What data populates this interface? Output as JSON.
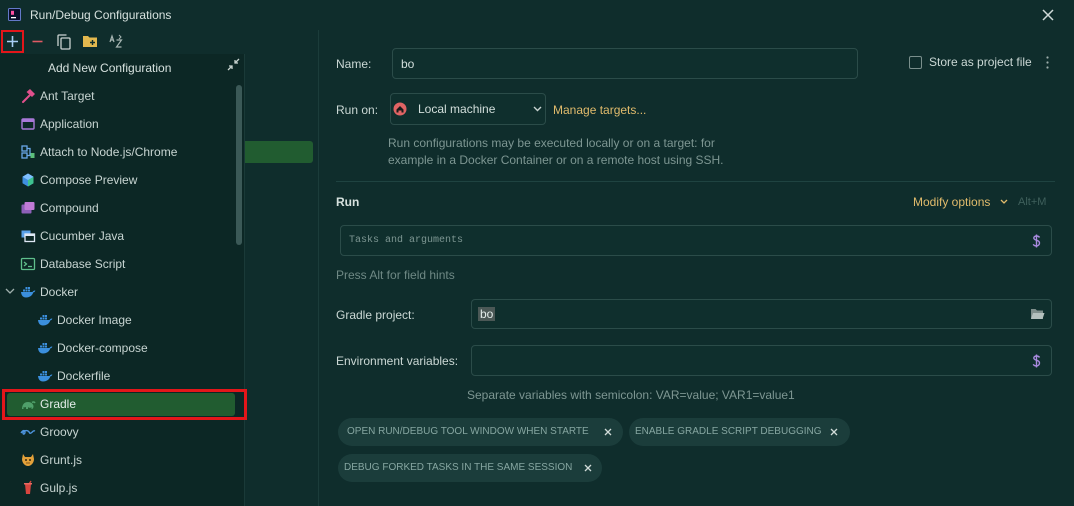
{
  "window": {
    "title": "Run/Debug Configurations",
    "app_icon": "intellij-app-icon",
    "close_icon": "close-icon"
  },
  "toolbar": {
    "icons": [
      "plus-icon",
      "minus-icon",
      "copy-icon",
      "folder-add-icon",
      "sort-alphabetically-icon"
    ],
    "add_highlighted": true
  },
  "popup": {
    "title": "Add New Configuration",
    "collapse_icon": "collapse-icon",
    "items": [
      {
        "label": "Ant Target",
        "icon": "ant-hammer-icon"
      },
      {
        "label": "Application",
        "icon": "application-window-icon"
      },
      {
        "label": "Attach to Node.js/Chrome",
        "icon": "attach-node-icon"
      },
      {
        "label": "Compose Preview",
        "icon": "compose-cube-icon"
      },
      {
        "label": "Compound",
        "icon": "compound-icon"
      },
      {
        "label": "Cucumber Java",
        "icon": "cucumber-java-icon"
      },
      {
        "label": "Database Script",
        "icon": "database-script-icon"
      },
      {
        "label": "Docker",
        "icon": "docker-icon",
        "expanded": true
      },
      {
        "label": "Docker Image",
        "icon": "docker-icon",
        "child": true
      },
      {
        "label": "Docker-compose",
        "icon": "docker-icon",
        "child": true
      },
      {
        "label": "Dockerfile",
        "icon": "docker-icon",
        "child": true
      },
      {
        "label": "Gradle",
        "icon": "gradle-elephant-icon",
        "selected": true,
        "highlighted": true
      },
      {
        "label": "Groovy",
        "icon": "groovy-icon"
      },
      {
        "label": "Grunt.js",
        "icon": "grunt-icon"
      },
      {
        "label": "Gulp.js",
        "icon": "gulp-icon"
      }
    ]
  },
  "config": {
    "name_label": "Name:",
    "name_value": "bo",
    "store_label": "Store as project file",
    "store_checked": false,
    "run_on_label": "Run on:",
    "run_on_value": "Local machine",
    "run_on_icon": "local-machine-icon",
    "manage_targets": "Manage targets...",
    "run_on_help": [
      "Run configurations may be executed locally or on a target: for",
      "example in a Docker Container or on a remote host using SSH."
    ]
  },
  "run": {
    "title": "Run",
    "modify_options": "Modify options",
    "modify_shortcut": "Alt+M",
    "tasks_placeholder": "Tasks and arguments",
    "tasks_value": "",
    "field_hint": "Press Alt for field hints",
    "gradle_project_label": "Gradle project:",
    "gradle_project_value": "bo",
    "env_label": "Environment variables:",
    "env_value": "",
    "env_hint": "Separate variables with semicolon: VAR=value; VAR1=value1",
    "options": [
      "OPEN RUN/DEBUG TOOL WINDOW WHEN STARTE",
      "ENABLE GRADLE SCRIPT DEBUGGING",
      "DEBUG FORKED TASKS IN THE SAME SESSION"
    ]
  },
  "colors": {
    "background": "#0f2d2c",
    "selection": "#215c30",
    "link": "#e1bb6c",
    "highlight_box": "#e3161a",
    "variable_icon": "#a98adf"
  }
}
